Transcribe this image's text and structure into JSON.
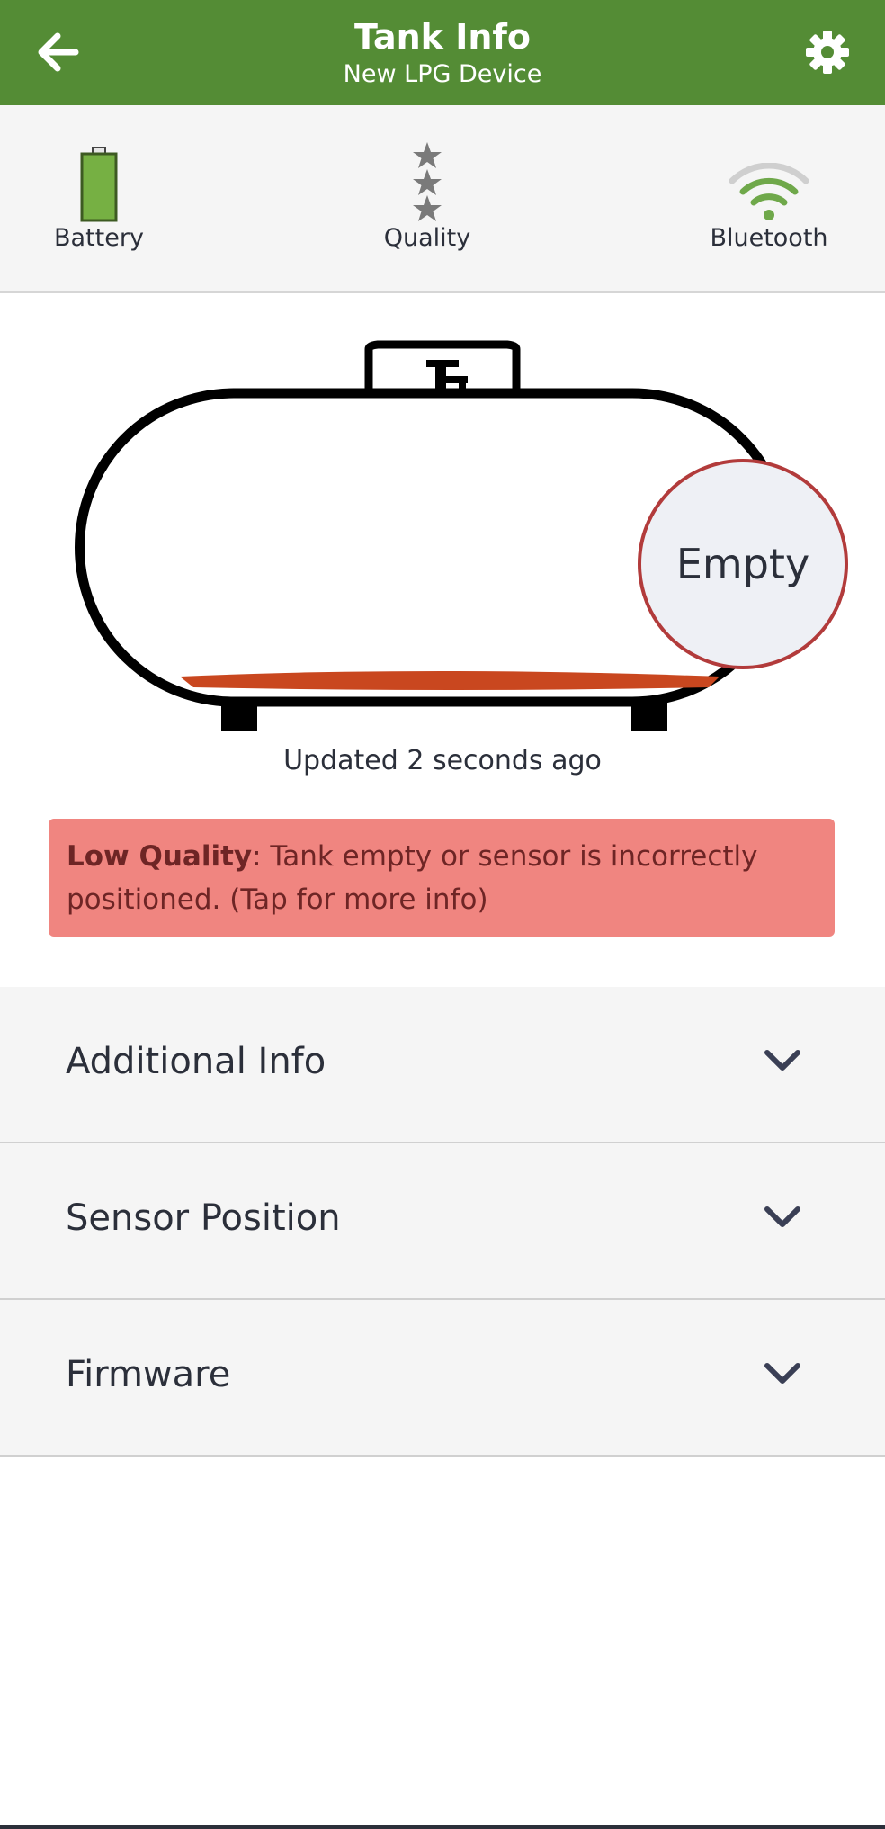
{
  "header": {
    "title": "Tank Info",
    "subtitle": "New LPG Device",
    "back_icon": "arrow-left-icon",
    "settings_icon": "gear-icon",
    "color": "#548c35"
  },
  "status": {
    "battery": {
      "label": "Battery",
      "icon": "battery-icon",
      "level": 1.0
    },
    "quality": {
      "label": "Quality",
      "icon": "stars-icon",
      "stars_filled": 0,
      "stars_total": 3
    },
    "bluetooth": {
      "label": "Bluetooth",
      "icon": "signal-icon",
      "bars_active": 2,
      "bars_total": 3
    }
  },
  "tank": {
    "level_label": "Empty",
    "updated_text": "Updated 2 seconds ago",
    "fill_color": "#c9471f",
    "badge_border_color": "#b23b3b"
  },
  "alert": {
    "bold": "Low Quality",
    "text": ": Tank empty or sensor is incorrectly positioned. (Tap for more info)",
    "background": "#f08580"
  },
  "sections": [
    {
      "label": "Additional Info"
    },
    {
      "label": "Sensor Position"
    },
    {
      "label": "Firmware"
    }
  ]
}
